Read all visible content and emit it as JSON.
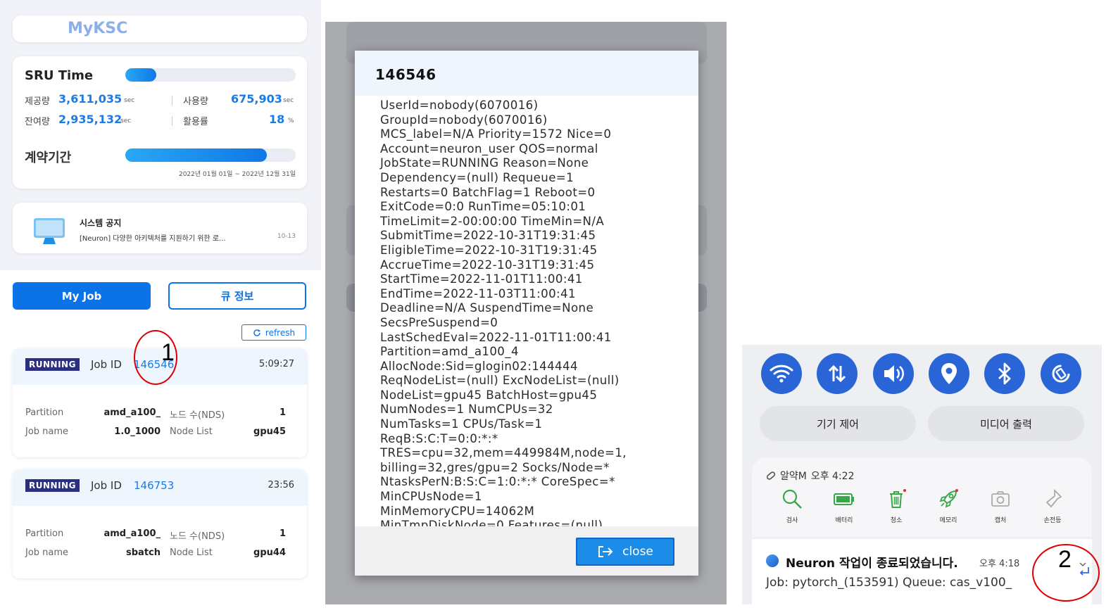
{
  "left": {
    "logo": "MyKSC",
    "sru": {
      "title": "SRU Time",
      "usage_fraction": 0.18,
      "provided_label": "제공량",
      "provided_value": "3,611,035",
      "used_label": "사용량",
      "used_value": "675,903",
      "remaining_label": "잔여량",
      "remaining_value": "2,935,132",
      "utilization_label": "활용률",
      "utilization_value": "18",
      "unit_sec": "sec",
      "unit_pct": "%"
    },
    "contract": {
      "title": "계약기간",
      "progress_fraction": 0.83,
      "range": "2022년 01월 01일 ~ 2022년 12월 31일"
    },
    "notice": {
      "title": "시스템 공지",
      "text": "[Neuron] 다양한 아키텍처를 지원하기 위한 로...",
      "date": "10-13"
    },
    "tabs": {
      "myjob": "My Job",
      "queue": "큐 정보"
    },
    "refresh": "refresh",
    "jobs": [
      {
        "status": "RUNNING",
        "id_label": "Job ID",
        "id": "146546",
        "time": "5:09:27",
        "partition_label": "Partition",
        "partition": "amd_a100_",
        "nodes_label": "노드 수(NDS)",
        "nodes": "1",
        "name_label": "Job name",
        "name": "1.0_1000",
        "nodelist_label": "Node List",
        "nodelist": "gpu45"
      },
      {
        "status": "RUNNING",
        "id_label": "Job ID",
        "id": "146753",
        "time": "23:56",
        "partition_label": "Partition",
        "partition": "amd_a100_",
        "nodes_label": "노드 수(NDS)",
        "nodes": "1",
        "name_label": "Job name",
        "name": "sbatch",
        "nodelist_label": "Node List",
        "nodelist": "gpu44"
      }
    ],
    "annotation": "1"
  },
  "modal": {
    "title": "146546",
    "lines": [
      "UserId=nobody(6070016)",
      "GroupId=nobody(6070016)",
      "MCS_label=N/A Priority=1572 Nice=0",
      "Account=neuron_user QOS=normal",
      "JobState=RUNNING Reason=None",
      "Dependency=(null) Requeue=1",
      "Restarts=0 BatchFlag=1 Reboot=0",
      "ExitCode=0:0 RunTime=05:10:01",
      "TimeLimit=2-00:00:00 TimeMin=N/A",
      "SubmitTime=2022-10-31T19:31:45",
      "EligibleTime=2022-10-31T19:31:45",
      "AccrueTime=2022-10-31T19:31:45",
      "StartTime=2022-11-01T11:00:41",
      "EndTime=2022-11-03T11:00:41",
      "Deadline=N/A SuspendTime=None",
      "SecsPreSuspend=0",
      "LastSchedEval=2022-11-01T11:00:41",
      "Partition=amd_a100_4",
      "AllocNode:Sid=glogin02:144444",
      "ReqNodeList=(null) ExcNodeList=(null)",
      "NodeList=gpu45 BatchHost=gpu45",
      "NumNodes=1 NumCPUs=32",
      "NumTasks=1 CPUs/Task=1",
      "ReqB:S:C:T=0:0:*:*",
      "TRES=cpu=32,mem=449984M,node=1,",
      "billing=32,gres/gpu=2 Socks/Node=*",
      "NtasksPerN:B:S:C=1:0:*:* CoreSpec=*",
      "MinCPUsNode=1",
      "MinMemoryCPU=14062M",
      "MinTmpDiskNode=0 Features=(null)"
    ],
    "close": "close"
  },
  "right": {
    "quick_settings": [
      "wifi-icon",
      "data-transfer-icon",
      "sound-icon",
      "location-icon",
      "bluetooth-icon",
      "auto-rotate-icon"
    ],
    "device_control": "기기 제어",
    "media_output": "미디어 출력",
    "notif1": {
      "app": "알약M",
      "time": "오후 4:22",
      "actions": [
        "검사",
        "배터리",
        "청소",
        "메모리",
        "캡처",
        "손전등"
      ]
    },
    "notif2": {
      "title": "Neuron 작업이 종료되었습니다.",
      "time": "오후 4:18",
      "body": "Job: pytorch_(153591) Queue: cas_v100_"
    },
    "annotation": "2"
  },
  "colors": {
    "accent": "#0b72e7",
    "badge": "#2a2f7e",
    "quick_setting": "#2965d6",
    "annotation": "#d00000"
  }
}
